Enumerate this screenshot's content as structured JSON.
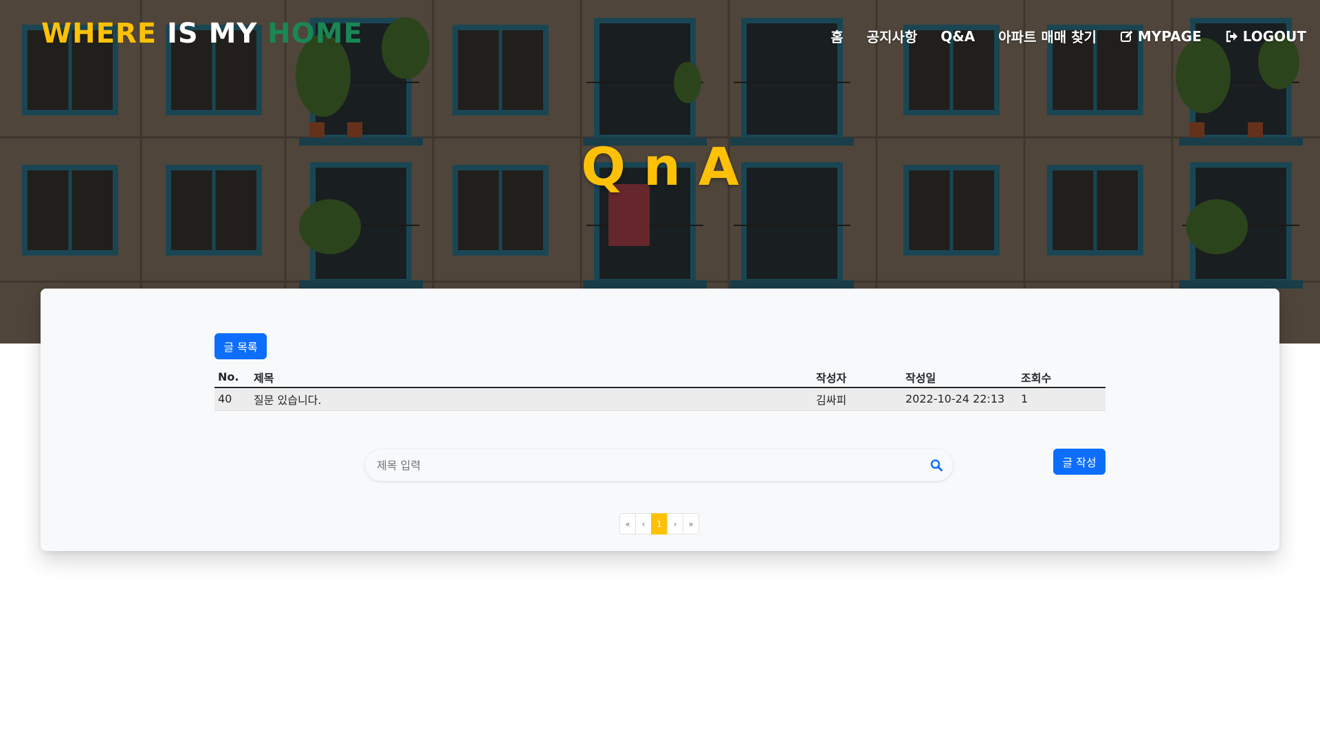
{
  "colors": {
    "brand_yellow": "#ffc107",
    "brand_white": "#ffffff",
    "brand_green": "#198754",
    "title_yellow": "#ffc107",
    "primary_blue": "#0d6efd",
    "active_page": "#ffc107"
  },
  "brand": {
    "part1": "WHERE ",
    "part2": "IS MY ",
    "part3": "HOME"
  },
  "nav": {
    "home": "홈",
    "notice": "공지사항",
    "qna": "Q&A",
    "apt": "아파트 매매 찾기",
    "mypage": "MYPAGE",
    "mypage_icon": "edit-icon",
    "logout": "LOGOUT",
    "logout_icon": "logout-icon"
  },
  "hero": {
    "title": "QnA"
  },
  "board": {
    "list_button": "글 목록",
    "write_button": "글 작성",
    "columns": {
      "no": "No.",
      "title": "제목",
      "author": "작성자",
      "date": "작성일",
      "views": "조회수"
    },
    "rows": [
      {
        "no": "40",
        "title": "질문 있습니다.",
        "author": "김싸피",
        "date": "2022-10-24 22:13",
        "views": "1"
      }
    ]
  },
  "search": {
    "placeholder": "제목 입력",
    "icon": "search-icon"
  },
  "pagination": {
    "first": "«",
    "prev": "‹",
    "current": "1",
    "next": "›",
    "last": "»"
  }
}
